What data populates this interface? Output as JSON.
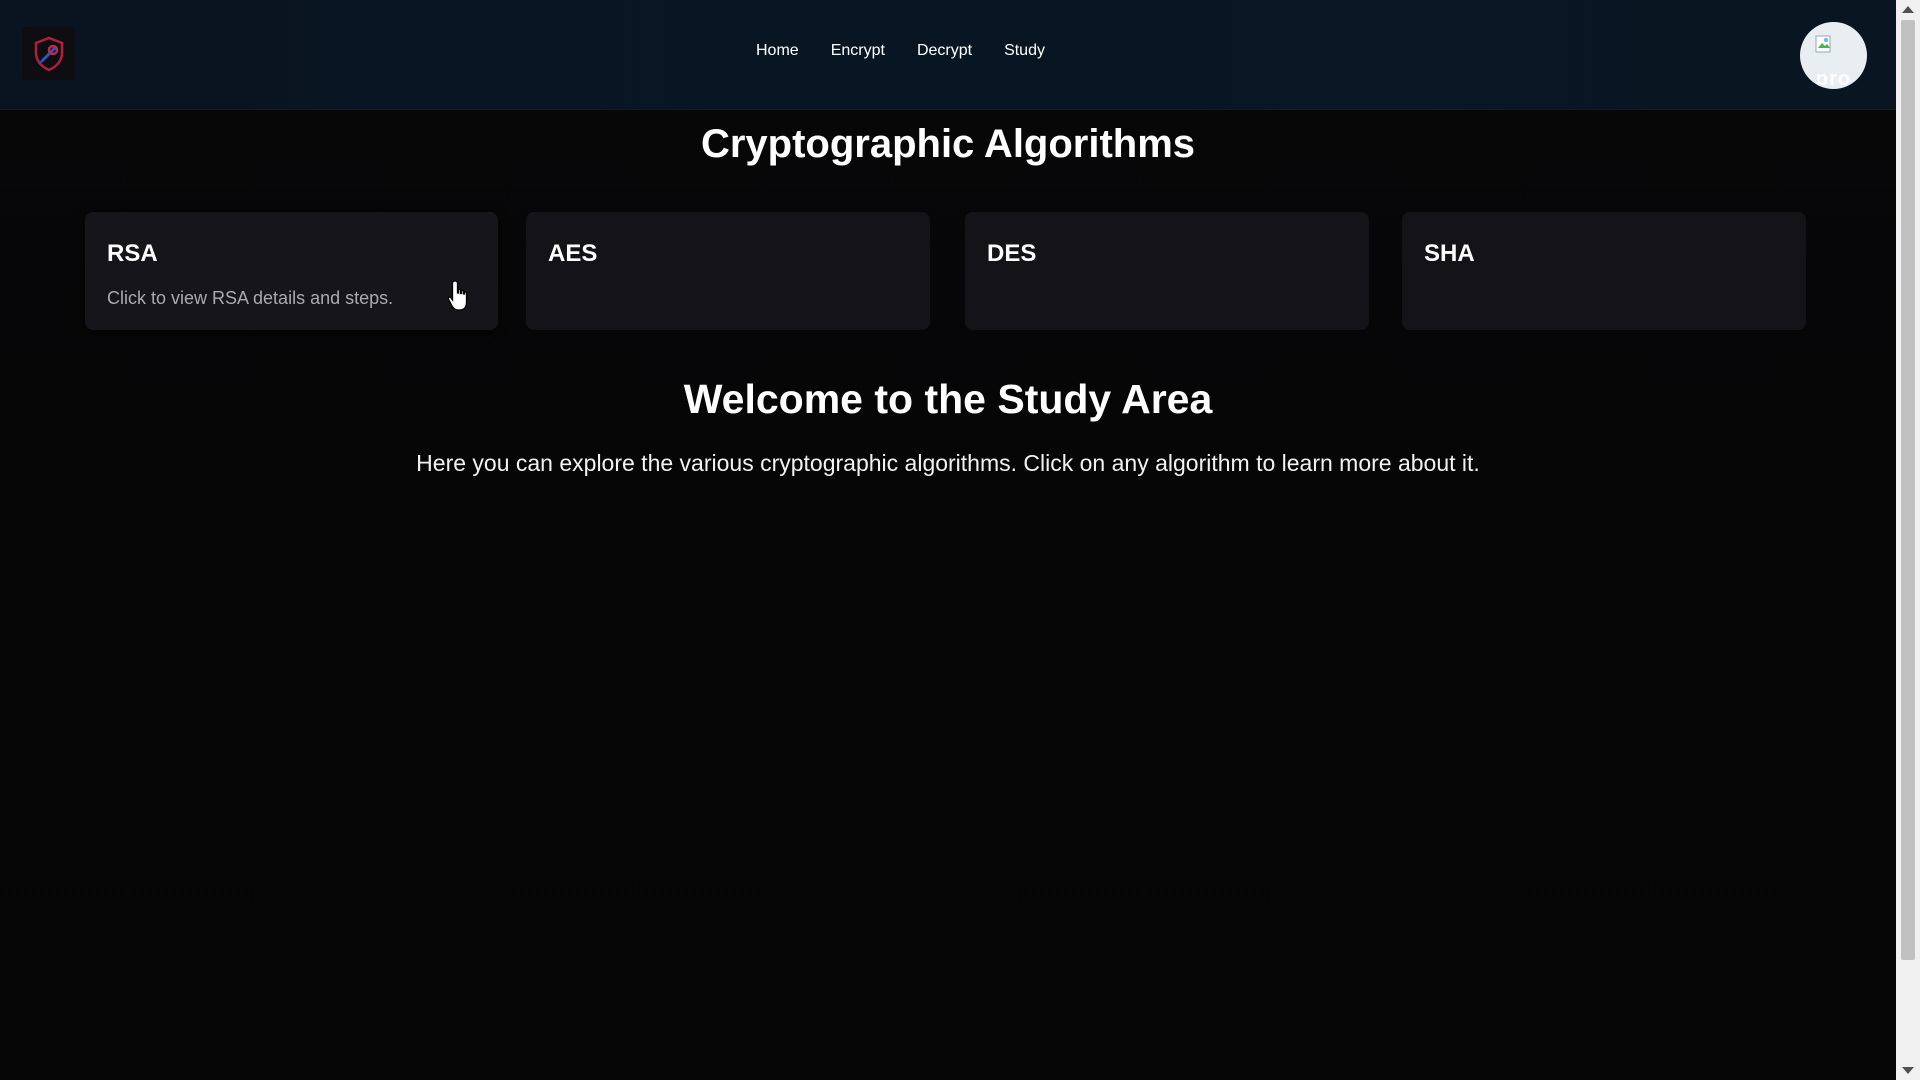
{
  "header": {
    "logo_icon": "shield-lock-icon",
    "nav": [
      "Home",
      "Encrypt",
      "Decrypt",
      "Study"
    ],
    "avatar_alt": "pro"
  },
  "main": {
    "title": "Cryptographic Algorithms",
    "cards": [
      {
        "name": "RSA",
        "description": "Click to view RSA details and steps."
      },
      {
        "name": "AES",
        "description": ""
      },
      {
        "name": "DES",
        "description": ""
      },
      {
        "name": "SHA",
        "description": ""
      }
    ],
    "welcome_title": "Welcome to the Study Area",
    "welcome_text": "Here you can explore the various cryptographic algorithms. Click on any algorithm to learn more about it."
  },
  "colors": {
    "header_bg": "#081624",
    "page_bg": "#060607",
    "card_bg": "#141418",
    "text_muted": "#a9a9ae"
  }
}
